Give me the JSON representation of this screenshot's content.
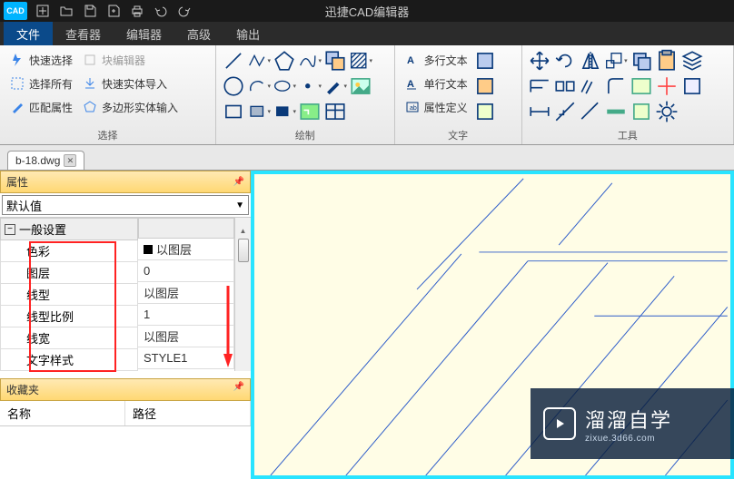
{
  "app": {
    "title": "迅捷CAD编辑器",
    "logo": "CAD"
  },
  "menu": {
    "items": [
      "文件",
      "查看器",
      "编辑器",
      "高级",
      "输出"
    ],
    "active_index": 0
  },
  "ribbon": {
    "groups": {
      "select": {
        "label": "选择",
        "quick_select": "快速选择",
        "select_all": "选择所有",
        "match_prop": "匹配属性",
        "block_editor": "块编辑器",
        "import_solid": "快速实体导入",
        "poly_input": "多边形实体输入"
      },
      "draw": {
        "label": "绘制"
      },
      "text": {
        "label": "文字",
        "mtext": "多行文本",
        "stext": "单行文本",
        "attr": "属性定义"
      },
      "tools": {
        "label": "工具"
      }
    }
  },
  "file_tab": {
    "name": "b-18.dwg"
  },
  "prop_panel": {
    "title": "属性",
    "default": "默认值",
    "section": "一般设置",
    "rows": {
      "color": {
        "label": "色彩",
        "value": "以图层"
      },
      "layer": {
        "label": "图层",
        "value": "0"
      },
      "ltype": {
        "label": "线型",
        "value": "以图层"
      },
      "lscale": {
        "label": "线型比例",
        "value": "1"
      },
      "lweight": {
        "label": "线宽",
        "value": "以图层"
      },
      "tstyle": {
        "label": "文字样式",
        "value": "STYLE1"
      }
    }
  },
  "favorites": {
    "title": "收藏夹",
    "col_name": "名称",
    "col_path": "路径"
  },
  "watermark": {
    "brand": "溜溜自学",
    "url": "zixue.3d66.com"
  }
}
